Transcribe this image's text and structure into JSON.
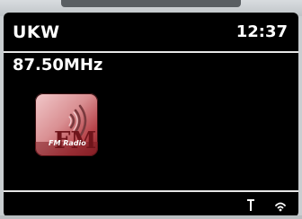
{
  "header": {
    "band": "UKW",
    "time": "12:37"
  },
  "station": {
    "frequency": "87.50MHz"
  },
  "tile": {
    "logo_large": "FM",
    "logo_caption": "FM Radio",
    "icon": "radio-waves-icon"
  },
  "status": {
    "icons": [
      "antenna-signal-icon",
      "wifi-icon"
    ]
  },
  "colors": {
    "screen_bg": "#000000",
    "text": "#ffffff",
    "tile_dark_red": "#8d2026",
    "tile_light_pink": "#f2c9cb"
  }
}
